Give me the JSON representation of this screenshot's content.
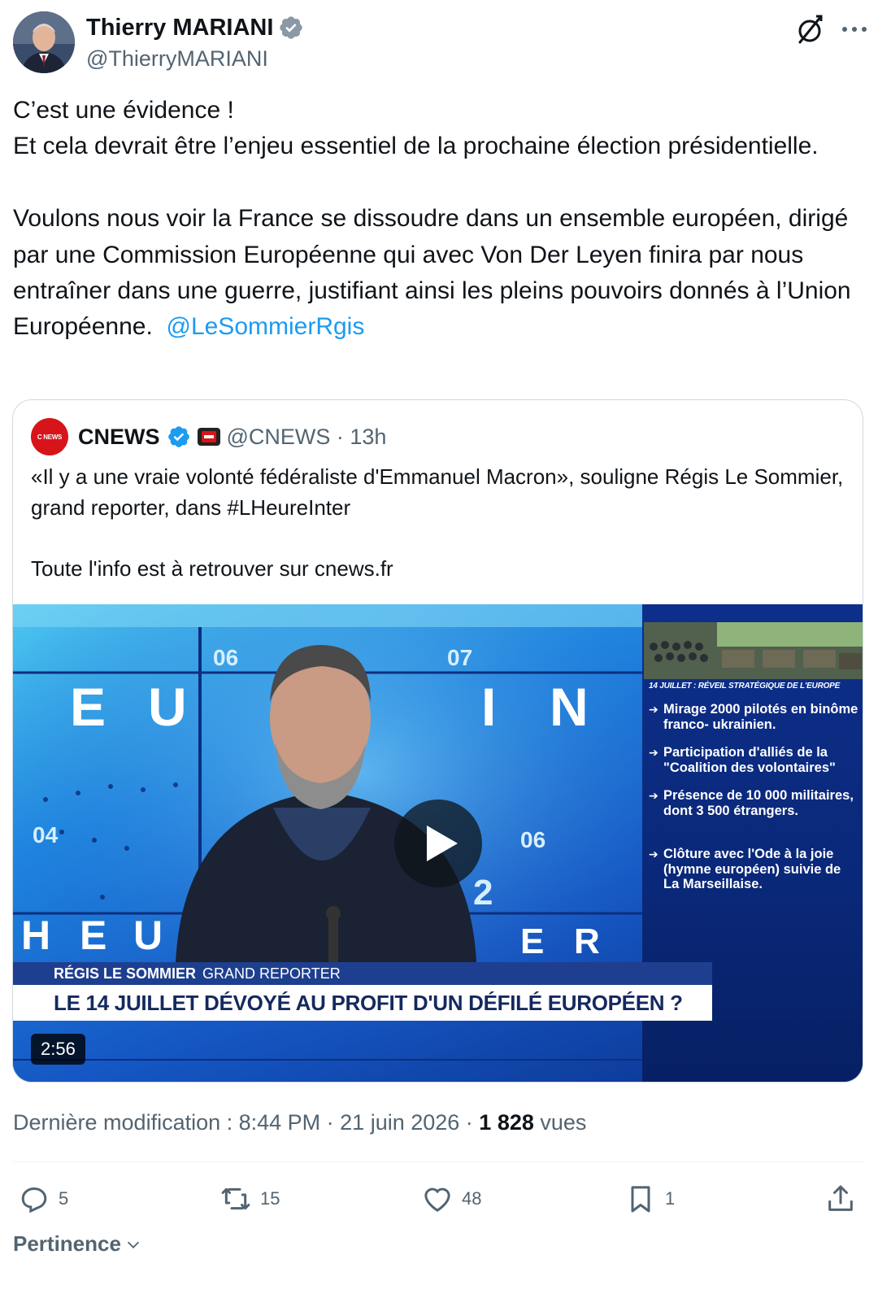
{
  "author": {
    "display_name": "Thierry MARIANI",
    "handle": "@ThierryMARIANI"
  },
  "tweet": {
    "text": "C’est une évidence !\nEt cela devrait être l’enjeu essentiel de la prochaine élection présidentielle.\n\nVoulons nous voir la France se dissoudre dans un ensemble européen, dirigé par une Commission Européenne qui avec Von Der Leyen finira par nous entraîner dans une guerre, justifiant ainsi les pleins pouvoirs donnés à l’Union Européenne.  ",
    "mention": "@LeSommierRgis"
  },
  "quoted": {
    "logo_text": "C NEWS",
    "name": "CNEWS",
    "handle_time": "@CNEWS · 13h",
    "text": "«Il y a une vraie volonté fédéraliste d'Emmanuel Macron», souligne Régis Le Sommier, grand reporter, dans #LHeureInter\n\nToute l'info est à retrouver sur cnews.fr",
    "video": {
      "studio_letters": [
        "E",
        "U",
        "I",
        "N",
        "H",
        "E",
        "U",
        "E",
        "R"
      ],
      "studio_numbers": [
        "06",
        "07",
        "04",
        "06",
        "2"
      ],
      "side_title": "14 JUILLET : RÉVEIL STRATÉGIQUE DE L'EUROPE",
      "side_items": [
        "Mirage 2000 pilotés en binôme franco- ukrainien.",
        "Participation d'alliés de la \"Coalition des volontaires\"",
        "Présence de 10 000 militaires, dont 3 500 étrangers.",
        "Clôture avec l'Ode à la joie (hymne européen) suivie de La Marseillaise."
      ],
      "lower_name": "RÉGIS LE SOMMIER",
      "lower_role": "GRAND REPORTER",
      "lower_title": "LE 14 JUILLET DÉVOYÉ AU PROFIT D'UN DÉFILÉ EUROPÉEN ?",
      "duration": "2:56"
    }
  },
  "meta": {
    "prefix": "Dernière modification : 8:44 PM · 21 juin 2026 · ",
    "views_count": "1 828",
    "views_label": " vues"
  },
  "actions": {
    "replies": "5",
    "reposts": "15",
    "likes": "48",
    "bookmarks": "1"
  },
  "sort_label": "Pertinence",
  "colors": {
    "accent": "#1d9bf0",
    "verified": "#1d9bf0",
    "muted": "#536471",
    "cnews_red": "#d7141a"
  }
}
